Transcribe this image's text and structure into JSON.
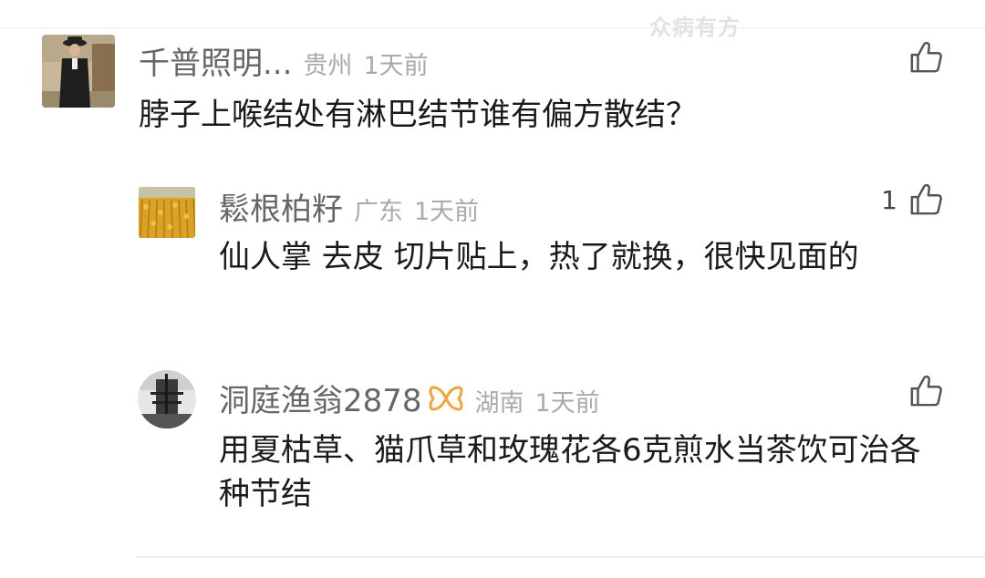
{
  "watermark": "众病有方",
  "comments": [
    {
      "username": "千普照明...",
      "region": "贵州",
      "time": "1天前",
      "content": "脖子上喉结处有淋巴结节谁有偏方散结？",
      "likes": "",
      "avatar": "man-in-hat-photo"
    },
    {
      "username": "鬆根柏籽",
      "region": "广东",
      "time": "1天前",
      "content": "仙人掌 去皮 切片贴上，热了就换，很快见面的",
      "likes": "1",
      "avatar": "wheat-field-photo"
    },
    {
      "username": "洞庭渔翁2878",
      "region": "湖南",
      "time": "1天前",
      "content": "用夏枯草、猫爪草和玫瑰花各6克煎水当茶饮可治各种节结",
      "likes": "",
      "avatar": "circular-bw-photo",
      "badge": "vip-ribbon-icon"
    }
  ],
  "colors": {
    "username": "#666666",
    "meta": "#aaaaaa",
    "content": "#1a1a1a",
    "badge": "#f2a33a"
  }
}
